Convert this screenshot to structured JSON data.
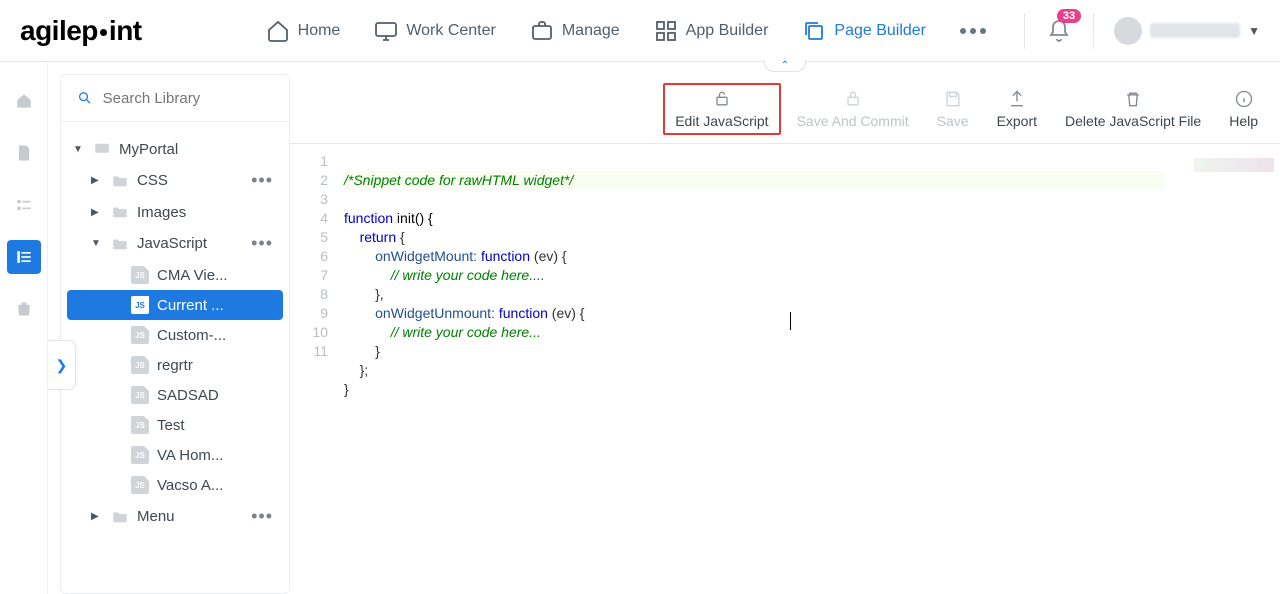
{
  "brand": "agilepoint",
  "notifications": "33",
  "nav": {
    "home": "Home",
    "work_center": "Work Center",
    "manage": "Manage",
    "app_builder": "App Builder",
    "page_builder": "Page Builder"
  },
  "search": {
    "placeholder": "Search Library"
  },
  "tree": {
    "root": "MyPortal",
    "css": "CSS",
    "images": "Images",
    "javascript": "JavaScript",
    "menu": "Menu",
    "files": {
      "cma": "CMA Vie...",
      "current": "Current ...",
      "custom": "Custom-...",
      "regrtr": "regrtr",
      "sadsad": "SADSAD",
      "test": "Test",
      "vahom": "VA Hom...",
      "vacso": "Vacso A..."
    }
  },
  "toolbar": {
    "edit_js": "Edit JavaScript",
    "save_commit": "Save And Commit",
    "save": "Save",
    "export": "Export",
    "delete_js": "Delete JavaScript File",
    "help": "Help"
  },
  "code": {
    "l1": "/*Snippet code for rawHTML widget*/",
    "l2a": "function",
    "l2b": " init() {",
    "l3a": "return",
    "l3b": " {",
    "l4a": "onWidgetMount: ",
    "l4b": "function",
    "l4c": " (ev) {",
    "l5": "// write your code here....",
    "l6": "},",
    "l7a": "onWidgetUnmount: ",
    "l7b": "function",
    "l7c": " (ev) {",
    "l8": "// write your code here...",
    "l9": "}",
    "l10": "};",
    "l11": "}"
  },
  "line_numbers": [
    "1",
    "2",
    "3",
    "4",
    "5",
    "6",
    "7",
    "8",
    "9",
    "10",
    "11"
  ]
}
